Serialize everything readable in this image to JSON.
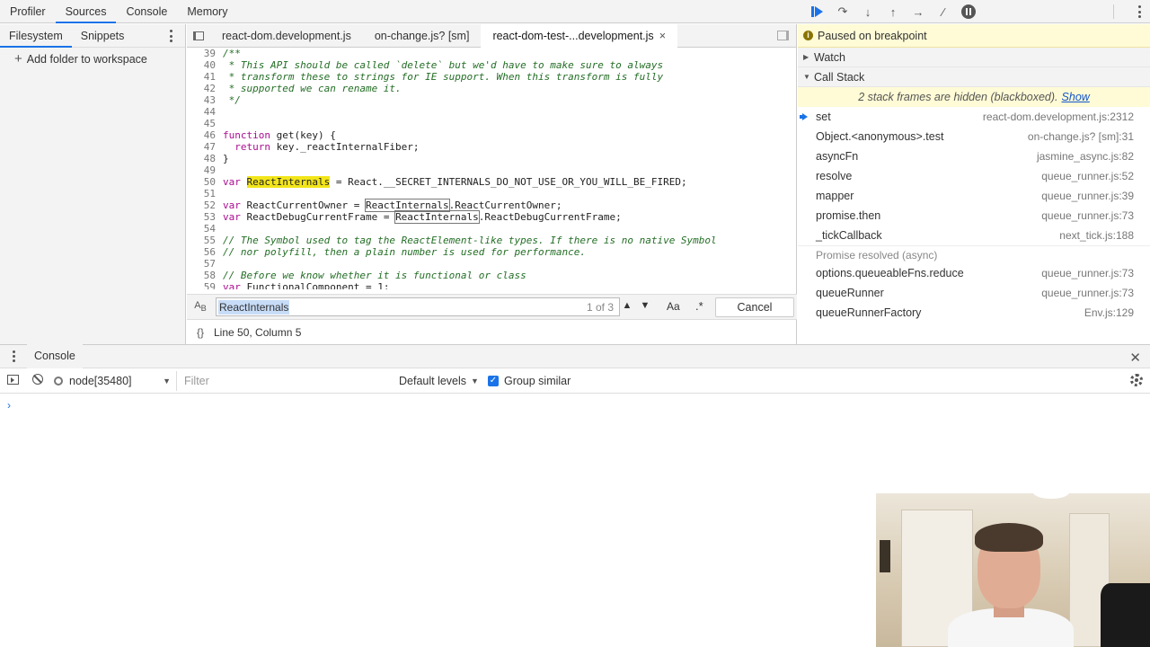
{
  "top_tabs": [
    "Profiler",
    "Sources",
    "Console",
    "Memory"
  ],
  "top_active": "Sources",
  "navigator": {
    "tabs": [
      "Filesystem",
      "Snippets"
    ],
    "add_folder": "Add folder to workspace"
  },
  "editor": {
    "tabs": [
      "react-dom.development.js",
      "on-change.js? [sm]",
      "react-dom-test-...development.js"
    ],
    "close_glyph": "×",
    "lines": [
      {
        "n": "39",
        "parts": [
          {
            "t": "/**",
            "c": "cm"
          }
        ]
      },
      {
        "n": "40",
        "parts": [
          {
            "t": " * This API should be called `delete` but we'd have to make sure to always",
            "c": "cm"
          }
        ]
      },
      {
        "n": "41",
        "parts": [
          {
            "t": " * transform these to strings for IE support. When this transform is fully",
            "c": "cm"
          }
        ]
      },
      {
        "n": "42",
        "parts": [
          {
            "t": " * supported we can rename it.",
            "c": "cm"
          }
        ]
      },
      {
        "n": "43",
        "parts": [
          {
            "t": " */",
            "c": "cm"
          }
        ]
      },
      {
        "n": "44",
        "parts": []
      },
      {
        "n": "45",
        "parts": []
      },
      {
        "n": "46",
        "parts": [
          {
            "t": "function",
            "c": "kw"
          },
          {
            "t": " get(key) {",
            "c": ""
          }
        ]
      },
      {
        "n": "47",
        "parts": [
          {
            "t": "  return",
            "c": "kw"
          },
          {
            "t": " key._reactInternalFiber;",
            "c": ""
          }
        ]
      },
      {
        "n": "48",
        "parts": [
          {
            "t": "}",
            "c": ""
          }
        ]
      },
      {
        "n": "49",
        "parts": []
      },
      {
        "n": "50",
        "parts": [
          {
            "t": "var",
            "c": "kw"
          },
          {
            "t": " ",
            "c": ""
          },
          {
            "t": "ReactInternals",
            "c": "hl"
          },
          {
            "t": " = React.__SECRET_INTERNALS_DO_NOT_USE_OR_YOU_WILL_BE_FIRED;",
            "c": ""
          }
        ]
      },
      {
        "n": "51",
        "parts": []
      },
      {
        "n": "52",
        "parts": [
          {
            "t": "var",
            "c": "kw"
          },
          {
            "t": " ReactCurrentOwner = ",
            "c": ""
          },
          {
            "t": "ReactInternals",
            "c": "hlbox"
          },
          {
            "t": ".ReactCurrentOwner;",
            "c": ""
          }
        ]
      },
      {
        "n": "53",
        "parts": [
          {
            "t": "var",
            "c": "kw"
          },
          {
            "t": " ReactDebugCurrentFrame = ",
            "c": ""
          },
          {
            "t": "ReactInternals",
            "c": "hlbox"
          },
          {
            "t": ".ReactDebugCurrentFrame;",
            "c": ""
          }
        ]
      },
      {
        "n": "54",
        "parts": []
      },
      {
        "n": "55",
        "parts": [
          {
            "t": "// The Symbol used to tag the ReactElement-like types. If there is no native Symbol",
            "c": "cm"
          }
        ]
      },
      {
        "n": "56",
        "parts": [
          {
            "t": "// nor polyfill, then a plain number is used for performance.",
            "c": "cm"
          }
        ]
      },
      {
        "n": "57",
        "parts": []
      },
      {
        "n": "58",
        "parts": [
          {
            "t": "// Before we know whether it is functional or class",
            "c": "cm"
          }
        ]
      },
      {
        "n": "59",
        "parts": [
          {
            "t": "var",
            "c": "kw"
          },
          {
            "t": " FunctionalComponent = 1;",
            "c": ""
          }
        ]
      }
    ],
    "search": {
      "value": "ReactInternals",
      "count": "1 of 3",
      "match_case": "Aa",
      "regex": ".*",
      "cancel": "Cancel"
    },
    "status": "Line 50, Column 5",
    "status_icon": "{}"
  },
  "debugger": {
    "paused": "Paused on breakpoint",
    "watch": "Watch",
    "call_stack": "Call Stack",
    "blackboxed": "2 stack frames are hidden (blackboxed).",
    "show": "Show",
    "frames": [
      {
        "fn": "set",
        "loc": "react-dom.development.js:2312",
        "selected": true
      },
      {
        "fn": "Object.<anonymous>.test",
        "loc": "on-change.js? [sm]:31"
      },
      {
        "fn": "asyncFn",
        "loc": "jasmine_async.js:82"
      },
      {
        "fn": "resolve",
        "loc": "queue_runner.js:52"
      },
      {
        "fn": "mapper",
        "loc": "queue_runner.js:39"
      },
      {
        "fn": "promise.then",
        "loc": "queue_runner.js:73"
      },
      {
        "fn": "_tickCallback",
        "loc": "next_tick.js:188"
      }
    ],
    "async_label": "Promise resolved (async)",
    "async_frames": [
      {
        "fn": "options.queueableFns.reduce",
        "loc": "queue_runner.js:73"
      },
      {
        "fn": "queueRunner",
        "loc": "queue_runner.js:73"
      },
      {
        "fn": "queueRunnerFactory",
        "loc": "Env.js:129"
      }
    ]
  },
  "console": {
    "tab": "Console",
    "context": "node[35480]",
    "filter_placeholder": "Filter",
    "levels": "Default levels",
    "group_similar": "Group similar",
    "prompt": "›"
  },
  "colors": {
    "accent": "#1a73e8",
    "highlight": "#f2e51a",
    "comment": "#236e25",
    "keyword": "#aa0d91",
    "paused_bg": "#fffbd6"
  }
}
